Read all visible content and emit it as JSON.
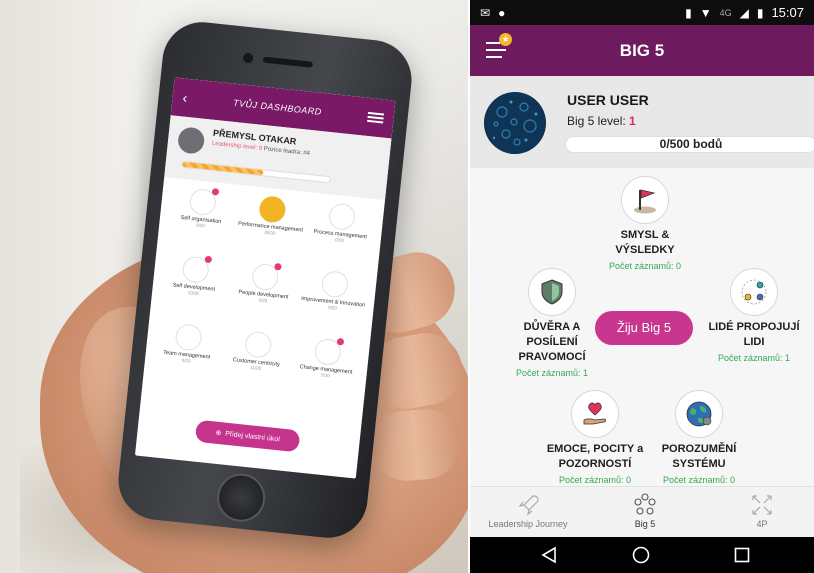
{
  "photo_phone": {
    "header_title": "TVŮJ DASHBOARD",
    "user_name": "PŘEMYSL OTAKAR",
    "leadership_level": "Leadership level: 9",
    "leader_position": "Pozice leadra: #4",
    "tiles": [
      {
        "label": "Self organisation",
        "sub": "0/20",
        "badge": true
      },
      {
        "label": "Performance management",
        "sub": "30/30",
        "badge": false
      },
      {
        "label": "Process management",
        "sub": "0/20",
        "badge": false
      },
      {
        "label": "Self development",
        "sub": "10/20",
        "badge": true
      },
      {
        "label": "People development",
        "sub": "0/20",
        "badge": true
      },
      {
        "label": "Improvement & Innovation",
        "sub": "0/20",
        "badge": false
      },
      {
        "label": "Team management",
        "sub": "0/20",
        "badge": false
      },
      {
        "label": "Customer centricity",
        "sub": "11/20",
        "badge": false
      },
      {
        "label": "Change management",
        "sub": "5/20",
        "badge": true
      }
    ],
    "add_button": "Přidej vlastní úkol"
  },
  "statusbar": {
    "time": "15:07",
    "network": "4G"
  },
  "appbar": {
    "title": "BIG 5"
  },
  "profile": {
    "name": "USER USER",
    "level_label": "Big 5 level:",
    "level_value": "1",
    "points": "0/500 bodů"
  },
  "nodes": {
    "smysl": {
      "line1": "SMYSL &",
      "line2": "VÝSLEDKY",
      "count": "Počet záznamů: 0"
    },
    "duvera": {
      "line1": "DŮVĚRA A",
      "line2": "POSÍLENÍ",
      "line3": "PRAVOMOCÍ",
      "count": "Počet záznamů: 1"
    },
    "lide": {
      "line1": "LIDÉ PROPOJUJÍ",
      "line2": "LIDI",
      "count": "Počet záznamů: 1"
    },
    "emoce": {
      "line1": "EMOCE, POCITY a",
      "line2": "POZORNOSTÍ",
      "count": "Počet záznamů: 0"
    },
    "porozumeni": {
      "line1": "POROZUMĚNÍ",
      "line2": "SYSTÉMU",
      "count": "Počet záznamů: 0"
    }
  },
  "center_button": "Žiju Big 5",
  "bottom_nav": [
    {
      "label": "Leadership Journey",
      "icon": "rocket-icon",
      "active": false
    },
    {
      "label": "Big 5",
      "icon": "circles-icon",
      "active": true
    },
    {
      "label": "4P",
      "icon": "arrows-icon",
      "active": false
    }
  ],
  "colors": {
    "appbar": "#6d1a5f",
    "accent_button": "#c8368f",
    "count_green": "#34a853",
    "level_red": "#e02856"
  }
}
